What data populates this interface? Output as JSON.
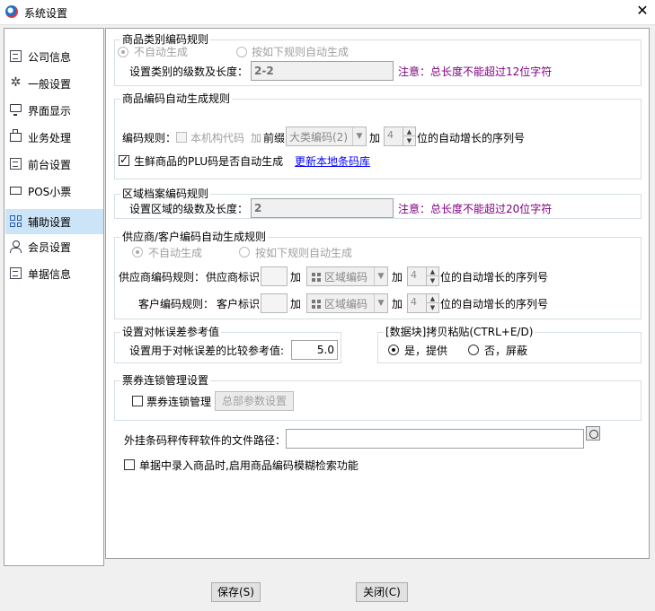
{
  "window": {
    "title": "系统设置",
    "close_glyph": "✕"
  },
  "sidebar": {
    "items": [
      {
        "label": "公司信息",
        "icon": "document-icon"
      },
      {
        "label": "一般设置",
        "icon": "gear-icon"
      },
      {
        "label": "界面显示",
        "icon": "monitor-icon"
      },
      {
        "label": "业务处理",
        "icon": "briefcase-icon"
      },
      {
        "label": "前台设置",
        "icon": "document-icon"
      },
      {
        "label": "POS小票",
        "icon": "pos-icon"
      },
      {
        "label": "辅助设置",
        "icon": "grid-icon",
        "active": true
      },
      {
        "label": "会员设置",
        "icon": "user-icon"
      },
      {
        "label": "单据信息",
        "icon": "document-icon"
      }
    ]
  },
  "category_code": {
    "title": "商品类别编码规则",
    "opt_manual": "不自动生成",
    "opt_auto": "按如下规则自动生成",
    "levels_label": "设置类别的级数及长度：",
    "levels_value": "2-2",
    "note": "注意：总长度不能超过12位字符"
  },
  "product_code": {
    "title": "商品编码自动生成规则",
    "rule_label": "编码规则：",
    "org_code_label": "本机构代码",
    "plus_label": "加",
    "prefix_label": "前缀",
    "prefix_value": "大类编码(2)",
    "plus2_label": "加",
    "digits_value": "4",
    "serial_suffix": "位的自动增长的序列号",
    "fresh_plu_label": "生鲜商品的PLU码是否自动生成",
    "update_barcode_link": "更新本地条码库"
  },
  "region_code": {
    "title": "区域档案编码规则",
    "levels_label": "设置区域的级数及长度：",
    "levels_value": "2",
    "note": "注意：总长度不能超过20位字符"
  },
  "supplier_code": {
    "title": "供应商/客户编码自动生成规则",
    "opt_manual": "不自动生成",
    "opt_auto": "按如下规则自动生成",
    "supplier_rule_label": "供应商编码规则：",
    "supplier_id_label": "供应商标识",
    "customer_rule_label": "客户编码规则：",
    "customer_id_label": "客户标识",
    "plus_label": "加",
    "region_combo": "区域编码",
    "digits_value": "4",
    "serial_suffix": "位的自动增长的序列号"
  },
  "reconcile": {
    "title": "设置对帐误差参考值",
    "label": "设置用于对帐误差的比较参考值:",
    "value": "5.0"
  },
  "copy_paste": {
    "title": "[数据块]拷贝粘贴(CTRL+E/D)",
    "opt_yes": "是，提供",
    "opt_no": "否，屏蔽"
  },
  "voucher": {
    "title": "票券连锁管理设置",
    "check_label": "票券连锁管理",
    "button_label": "总部参数设置"
  },
  "scale_path": {
    "label": "外挂条码秤传秤软件的文件路径：",
    "value": ""
  },
  "fuzzy_search": {
    "label": "单据中录入商品时,启用商品编码模糊检索功能"
  },
  "footer": {
    "save_label": "保存(S)",
    "close_label": "关闭(C)"
  }
}
